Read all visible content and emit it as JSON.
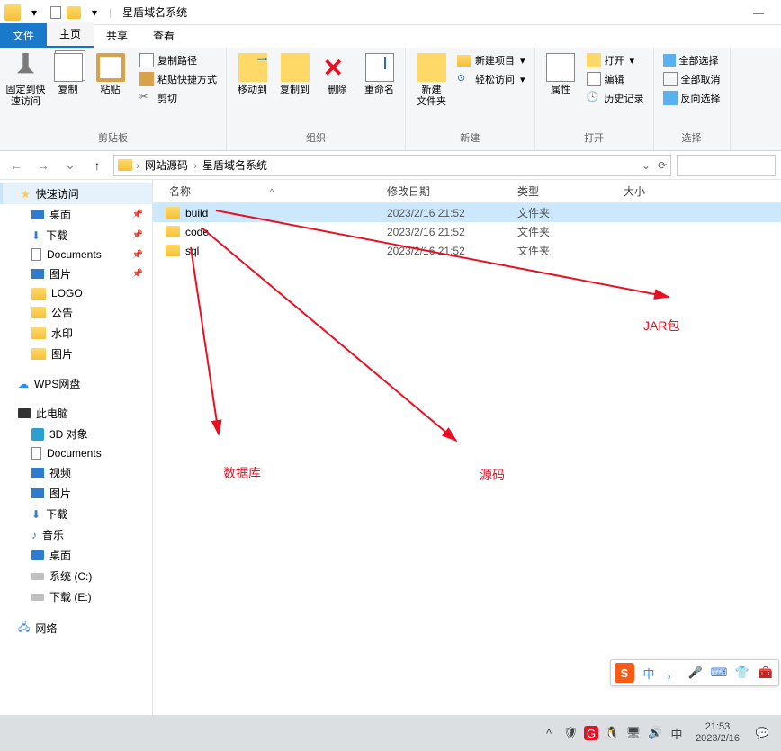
{
  "titlebar": {
    "title": "星盾域名系统"
  },
  "tabs": {
    "file": "文件",
    "home": "主页",
    "share": "共享",
    "view": "查看"
  },
  "ribbon": {
    "pin": "固定到快\n速访问",
    "copy": "复制",
    "paste": "粘贴",
    "copy_path": "复制路径",
    "paste_shortcut": "粘贴快捷方式",
    "cut": "剪切",
    "group_clipboard": "剪贴板",
    "move_to": "移动到",
    "copy_to": "复制到",
    "delete": "删除",
    "rename": "重命名",
    "group_organize": "组织",
    "new_folder": "新建\n文件夹",
    "new_item": "新建项目",
    "easy_access": "轻松访问",
    "group_new": "新建",
    "properties": "属性",
    "open": "打开",
    "edit": "编辑",
    "history": "历史记录",
    "group_open": "打开",
    "select_all": "全部选择",
    "select_none": "全部取消",
    "invert": "反向选择",
    "group_select": "选择"
  },
  "breadcrumb": {
    "a": "网站源码",
    "b": "星盾域名系统"
  },
  "columns": {
    "name": "名称",
    "date": "修改日期",
    "type": "类型",
    "size": "大小"
  },
  "files": [
    {
      "name": "build",
      "date": "2023/2/16 21:52",
      "type": "文件夹",
      "selected": true
    },
    {
      "name": "code",
      "date": "2023/2/16 21:52",
      "type": "文件夹",
      "selected": false
    },
    {
      "name": "sql",
      "date": "2023/2/16 21:52",
      "type": "文件夹",
      "selected": false
    }
  ],
  "sidebar": {
    "quick_access": "快速访问",
    "desktop": "桌面",
    "downloads": "下载",
    "documents": "Documents",
    "pictures": "图片",
    "logo": "LOGO",
    "notice": "公告",
    "watermark": "水印",
    "pictures2": "图片",
    "wps": "WPS网盘",
    "this_pc": "此电脑",
    "d3": "3D 对象",
    "docs2": "Documents",
    "video": "视频",
    "pics3": "图片",
    "dl2": "下载",
    "music": "音乐",
    "desktop2": "桌面",
    "sysdrive": "系统 (C:)",
    "dldrive": "下载 (E:)",
    "network": "网络"
  },
  "annotations": {
    "jar": "JAR包",
    "source": "源码",
    "db": "数据库"
  },
  "ime": {
    "zhong": "中"
  },
  "taskbar": {
    "zhong": "中",
    "time": "21:53",
    "date": "2023/2/16"
  }
}
